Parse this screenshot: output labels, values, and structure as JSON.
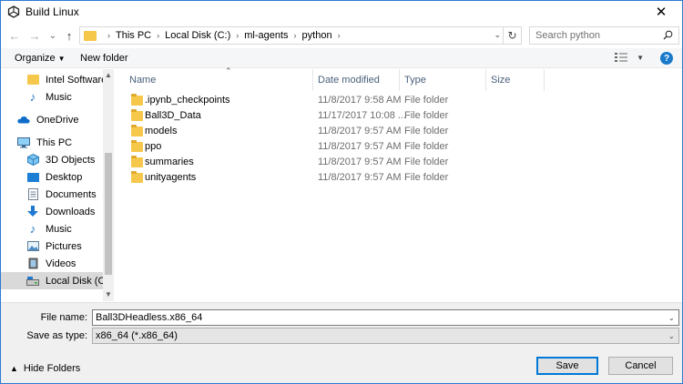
{
  "window": {
    "title": "Build Linux",
    "close_glyph": "✕"
  },
  "nav": {
    "back_glyph": "←",
    "forward_glyph": "→",
    "recent_glyph": "⌄",
    "up_glyph": "↑",
    "breadcrumbs": [
      "This PC",
      "Local Disk (C:)",
      "ml-agents",
      "python"
    ],
    "separator": "›",
    "refresh_glyph": "↻",
    "search_placeholder": "Search python"
  },
  "toolbar": {
    "organize_label": "Organize",
    "new_folder_label": "New folder",
    "help_label": "?"
  },
  "sidebar": {
    "items": [
      {
        "label": "Intel Software Pr",
        "icon": "folder-icon"
      },
      {
        "label": "Music",
        "icon": "music-icon"
      },
      {
        "label": "OneDrive",
        "icon": "onedrive-icon"
      },
      {
        "label": "This PC",
        "icon": "computer-icon"
      },
      {
        "label": "3D Objects",
        "icon": "cube-icon"
      },
      {
        "label": "Desktop",
        "icon": "desktop-icon"
      },
      {
        "label": "Documents",
        "icon": "document-icon"
      },
      {
        "label": "Downloads",
        "icon": "download-icon"
      },
      {
        "label": "Music",
        "icon": "music-icon"
      },
      {
        "label": "Pictures",
        "icon": "picture-icon"
      },
      {
        "label": "Videos",
        "icon": "video-icon"
      },
      {
        "label": "Local Disk (C:)",
        "icon": "disk-icon",
        "selected": true
      }
    ]
  },
  "filelist": {
    "columns": [
      "Name",
      "Date modified",
      "Type",
      "Size"
    ],
    "rows": [
      {
        "name": ".ipynb_checkpoints",
        "date": "11/8/2017 9:58 AM",
        "type": "File folder",
        "size": ""
      },
      {
        "name": "Ball3D_Data",
        "date": "11/17/2017 10:08 ...",
        "type": "File folder",
        "size": ""
      },
      {
        "name": "models",
        "date": "11/8/2017 9:57 AM",
        "type": "File folder",
        "size": ""
      },
      {
        "name": "ppo",
        "date": "11/8/2017 9:57 AM",
        "type": "File folder",
        "size": ""
      },
      {
        "name": "summaries",
        "date": "11/8/2017 9:57 AM",
        "type": "File folder",
        "size": ""
      },
      {
        "name": "unityagents",
        "date": "11/8/2017 9:57 AM",
        "type": "File folder",
        "size": ""
      }
    ]
  },
  "bottom": {
    "file_name_label": "File name:",
    "file_name_value": "Ball3DHeadless.x86_64",
    "save_type_label": "Save as type:",
    "save_type_value": "x86_64 (*.x86_64)",
    "hide_folders_label": "Hide Folders",
    "save_label": "Save",
    "cancel_label": "Cancel"
  },
  "colors": {
    "accent": "#0078d7",
    "folder": "#f5c84c",
    "selection": "#d9d9d9",
    "header_text": "#4c607a"
  }
}
